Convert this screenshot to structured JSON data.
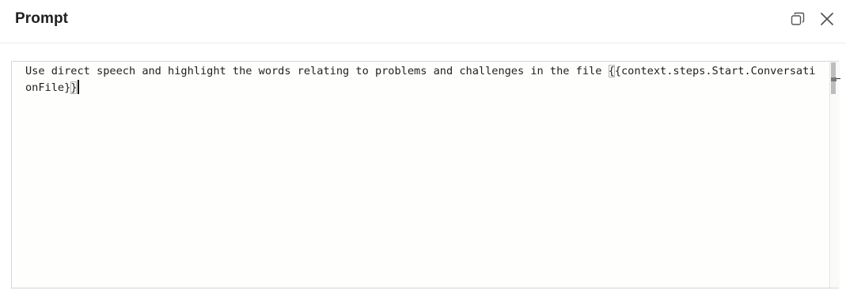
{
  "dialog": {
    "title": "Prompt",
    "restore_icon": "restore-window-icon",
    "close_icon": "close-icon"
  },
  "editor": {
    "text_before": "Use direct speech and highlight the words relating to problems and challenges in the file ",
    "open_brace_1": "{",
    "middle": "{context.steps.Start.ConversationFile}",
    "close_brace_2": "}"
  },
  "colors": {
    "title": "#1f1f1f",
    "editor_background": "#fefefc",
    "editor_border": "#d6d6d6",
    "text": "#1e1e1e"
  }
}
